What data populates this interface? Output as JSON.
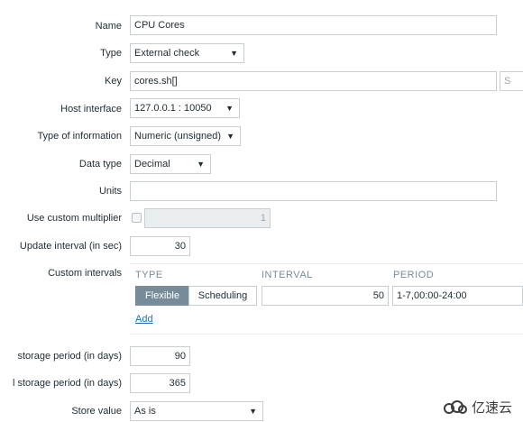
{
  "form": {
    "name": {
      "label": "Name",
      "value": "CPU Cores"
    },
    "type": {
      "label": "Type",
      "value": "External check"
    },
    "key": {
      "label": "Key",
      "value": "cores.sh[]",
      "button": "S"
    },
    "host_interface": {
      "label": "Host interface",
      "value": "127.0.0.1 : 10050"
    },
    "type_of_information": {
      "label": "Type of information",
      "value": "Numeric (unsigned)"
    },
    "data_type": {
      "label": "Data type",
      "value": "Decimal"
    },
    "units": {
      "label": "Units",
      "value": ""
    },
    "custom_multiplier": {
      "label": "Use custom multiplier",
      "value": "1",
      "checked": false
    },
    "update_interval": {
      "label": "Update interval (in sec)",
      "value": "30"
    },
    "custom_intervals": {
      "label": "Custom intervals",
      "headers": [
        "TYPE",
        "INTERVAL",
        "PERIOD"
      ],
      "modes": [
        "Flexible",
        "Scheduling"
      ],
      "active_mode": "Flexible",
      "interval": "50",
      "period": "1-7,00:00-24:00",
      "add_label": "Add"
    },
    "history_storage": {
      "label": "storage period (in days)",
      "value": "90"
    },
    "trend_storage": {
      "label": "l storage period (in days)",
      "value": "365"
    },
    "store_value": {
      "label": "Store value",
      "value": "As is"
    }
  },
  "watermark": {
    "text": "亿速云"
  },
  "colors": {
    "accent": "#768d99",
    "link": "#1f6fb6",
    "border": "#c7cfd3",
    "disabled_bg": "#ebeef0"
  }
}
